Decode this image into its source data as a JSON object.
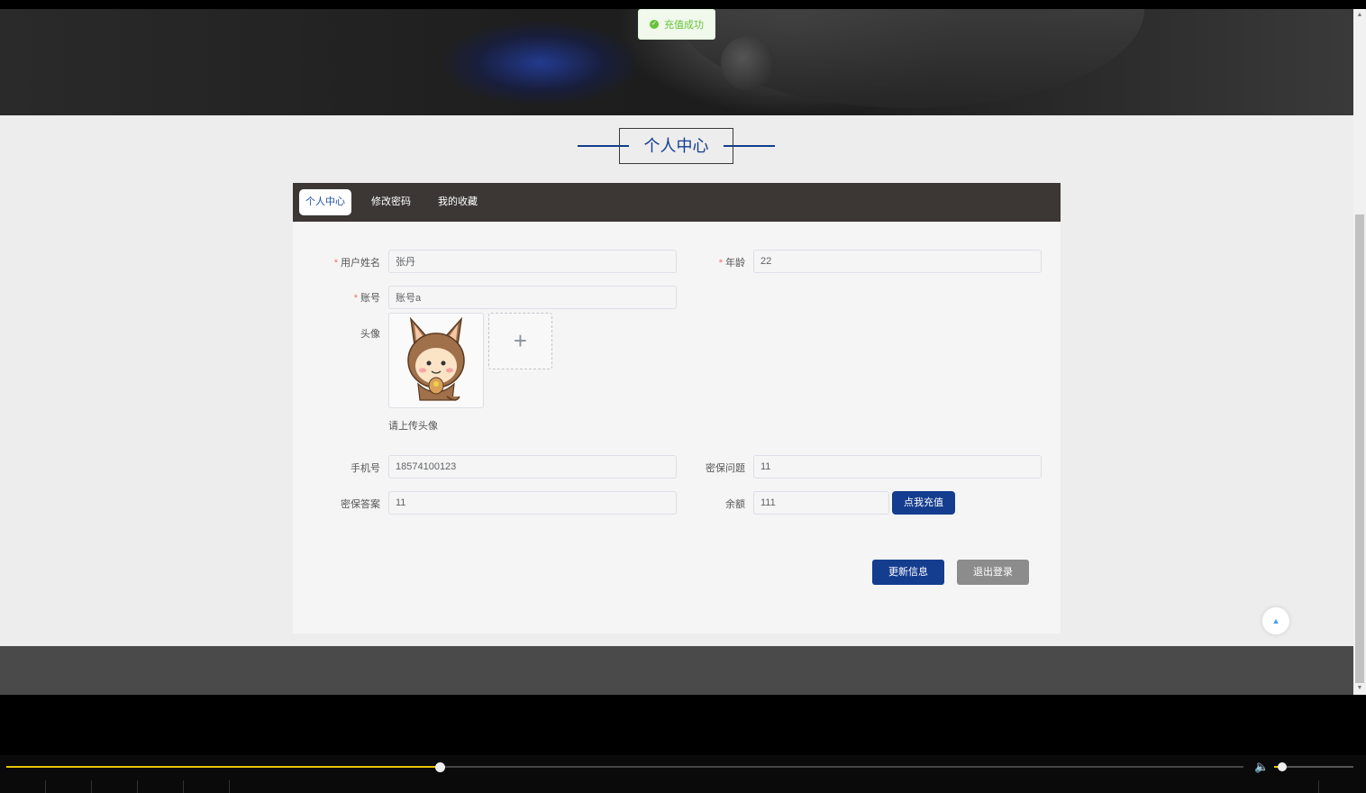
{
  "toast": {
    "message": "充值成功"
  },
  "section": {
    "title": "个人中心"
  },
  "tabs": [
    {
      "label": "个人中心",
      "active": true
    },
    {
      "label": "修改密码",
      "active": false
    },
    {
      "label": "我的收藏",
      "active": false
    }
  ],
  "form": {
    "name": {
      "label": "用户姓名",
      "value": "张丹",
      "required": true
    },
    "age": {
      "label": "年龄",
      "value": "22",
      "required": true
    },
    "account": {
      "label": "账号",
      "value": "账号a",
      "required": true
    },
    "avatar": {
      "label": "头像",
      "hint": "请上传头像"
    },
    "phone": {
      "label": "手机号",
      "value": "18574100123"
    },
    "security_question": {
      "label": "密保问题",
      "value": "11"
    },
    "security_answer": {
      "label": "密保答案",
      "value": "11"
    },
    "balance": {
      "label": "余额",
      "value": "111",
      "recharge_label": "点我充值"
    }
  },
  "actions": {
    "update_label": "更新信息",
    "logout_label": "退出登录"
  },
  "colors": {
    "brand": "#143d8f",
    "tabbar": "#3c3735",
    "footer": "#4a4a4a",
    "success": "#67c23a",
    "logout": "#8c8c8c"
  },
  "player": {
    "progress": 0.35,
    "volume": 0.1
  }
}
